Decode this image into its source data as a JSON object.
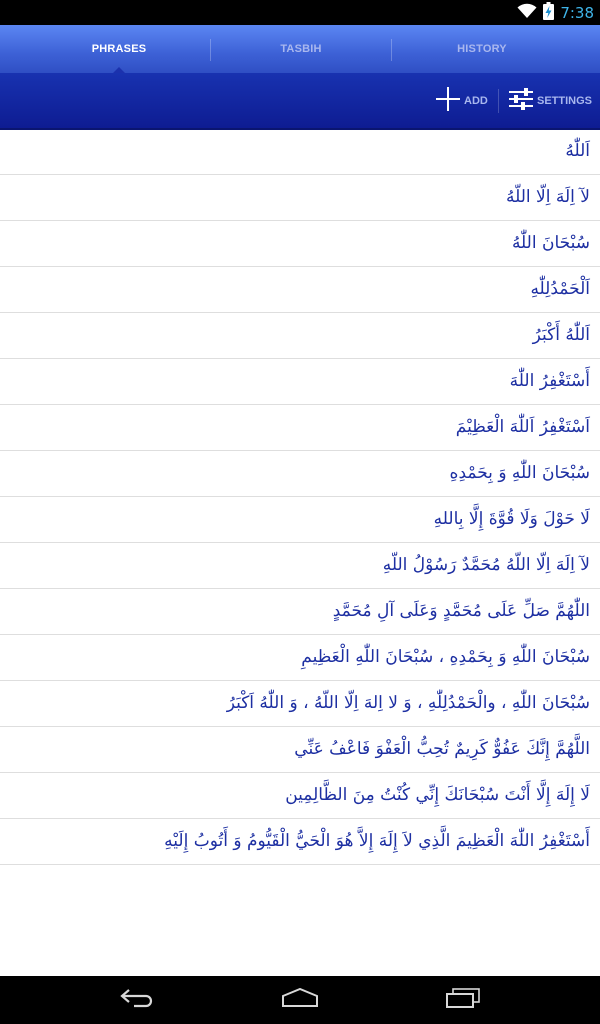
{
  "status_bar": {
    "time": "7:38",
    "icons": [
      "wifi-icon",
      "battery-charging-icon"
    ],
    "time_color": "#3fb4e8"
  },
  "tabs": [
    {
      "label": "PHRASES",
      "active": true
    },
    {
      "label": "TASBIH",
      "active": false
    },
    {
      "label": "HISTORY",
      "active": false
    }
  ],
  "actions": {
    "add_label": "ADD",
    "settings_label": "SETTINGS"
  },
  "phrases": [
    "اَللّٰهُ",
    "لآ اِلَهَ اِلّا اللّهُ",
    "سُبْحَانَ اللّٰهُ",
    "اَلْحَمْدُلِلّٰهِ",
    "اَللّٰهُ أَكْبَرُ",
    "أَسْتَغْفِرُ اللّٰهَ",
    "اَسْتَغْفِرُ اَللّٰهَ الْعَظِيْمَ",
    "سُبْحَانَ اللّٰهِ وَ بِحَمْدِهِ",
    "لَا حَوْلَ وَلَا قُوَّةَ إِلَّا بِاللهِ",
    "لآ اِلَهَ اِلّا اللّهُ مُحَمَّدٌ رَسُوْلُ اللّهِ",
    "اللّٰهُمَّ صَلِّ عَلَى مُحَمَّدٍ وَعَلَى آلِ مُحَمَّدٍ",
    "سُبْحَانَ اللّٰهِ وَ بِحَمْدِهِ ، سُبْحَانَ اللّٰهِ الْعَظِيمِ",
    "سُبْحَانَ اللّٰهِ ، والْحَمْدُلِلّٰهِ ، وَ لا اِلهَ اِلّا اللّهُ ، وَ اللّٰهُ اَكْبَرُ",
    "اللَّهُمَّ إِنَّكَ عَفُوٌّ كَرِيمٌ تُحِبُّ الْعَفْوَ فَاعْفُ عَنِّي",
    "لَا إِلَهَ إِلَّا أَنْتَ سُبْحَانَكَ إِنِّي كُنْتُ مِنَ الظَّالِمِين",
    "أَسْتَغْفِرُ اللّٰهَ الْعَظِيمَ الَّذِي لاَ إِلَهَ إِلاَّ هُوَ الْحَيُّ الْقَيُّومُ وَ أَتُوبُ إِلَيْهِ"
  ],
  "nav_bar": {
    "buttons": [
      "back-icon",
      "home-icon",
      "recent-apps-icon"
    ]
  }
}
